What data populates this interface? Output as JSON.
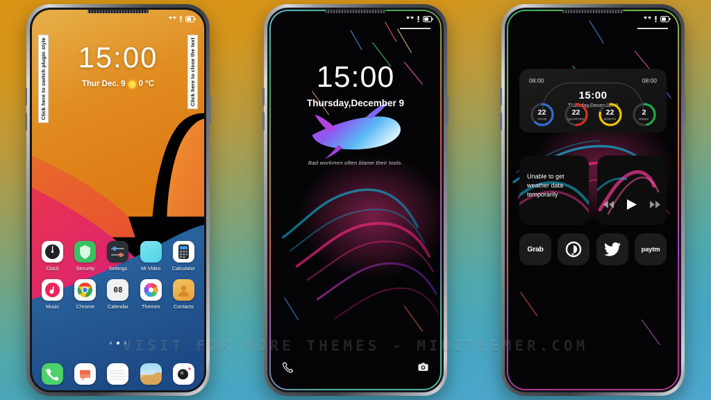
{
  "watermark": "VISIT FOR MORE THEMES - MIUITHEMER.COM",
  "phone1": {
    "status": {
      "signal": "signal-icon",
      "data": "data-icon",
      "battery": "battery-icon"
    },
    "hint_left": "Click here to switch plugin style",
    "hint_right": "Click here to close the text",
    "clock": {
      "time": "15:00",
      "date": "Thur Dec. 9",
      "weather_icon": "sun-icon",
      "temperature": "0 °C"
    },
    "apps": [
      {
        "label": "Clock",
        "icon": "clock-app-icon"
      },
      {
        "label": "Security",
        "icon": "shield-icon"
      },
      {
        "label": "Settings",
        "icon": "sliders-icon"
      },
      {
        "label": "Mi Video",
        "icon": "video-icon"
      },
      {
        "label": "Calculator",
        "icon": "calculator-icon"
      },
      {
        "label": "Music",
        "icon": "music-note-icon"
      },
      {
        "label": "Chrome",
        "icon": "chrome-icon"
      },
      {
        "label": "Calendar",
        "icon": "calendar-icon",
        "day": "08"
      },
      {
        "label": "Themes",
        "icon": "color-wheel-icon"
      },
      {
        "label": "Contacts",
        "icon": "person-icon"
      }
    ],
    "page_dots": {
      "count": 3,
      "active": 1
    },
    "dock": [
      {
        "label": "Phone",
        "icon": "phone-icon"
      },
      {
        "label": "Messages",
        "icon": "message-icon"
      },
      {
        "label": "Notes",
        "icon": "notes-icon"
      },
      {
        "label": "Gallery",
        "icon": "gallery-icon"
      },
      {
        "label": "Camera",
        "icon": "camera-icon"
      }
    ]
  },
  "phone2": {
    "status": {
      "signal": "signal-icon",
      "data": "data-icon",
      "battery": "battery-icon"
    },
    "clock": {
      "time": "15:00",
      "date": "Thursday,December 9"
    },
    "quote": "Bad workmen often blame their tools.",
    "bottom_left_icon": "phone-icon",
    "bottom_right_icon": "camera-icon"
  },
  "phone3": {
    "status": {
      "signal": "signal-icon",
      "data": "data-icon",
      "battery": "battery-icon"
    },
    "clock_widget": {
      "left_time": "08:00",
      "right_time": "08:00",
      "time": "15:00",
      "date": "Thursday,December 9",
      "rings": [
        {
          "value": "22",
          "label": "YEAR",
          "color": "#2f6fd0",
          "pct": 62
        },
        {
          "value": "22",
          "label": "QUARTER",
          "color": "#d93025",
          "pct": 50
        },
        {
          "value": "22",
          "label": "MONTH",
          "color": "#f2c200",
          "pct": 78
        },
        {
          "value": "2",
          "label": "WEEK",
          "color": "#1eaa4b",
          "pct": 46
        }
      ]
    },
    "weather_widget": {
      "text": "Unable to get weather data temporarily"
    },
    "music_widget": {
      "prev_icon": "rewind-icon",
      "play_icon": "play-icon",
      "next_icon": "fast-forward-icon"
    },
    "shortcuts": [
      {
        "label": "Grab",
        "icon": "grab-icon"
      },
      {
        "label": "",
        "icon": "circle-logo-icon"
      },
      {
        "label": "",
        "icon": "twitter-icon"
      },
      {
        "label": "paytm",
        "icon": "paytm-icon"
      }
    ]
  }
}
